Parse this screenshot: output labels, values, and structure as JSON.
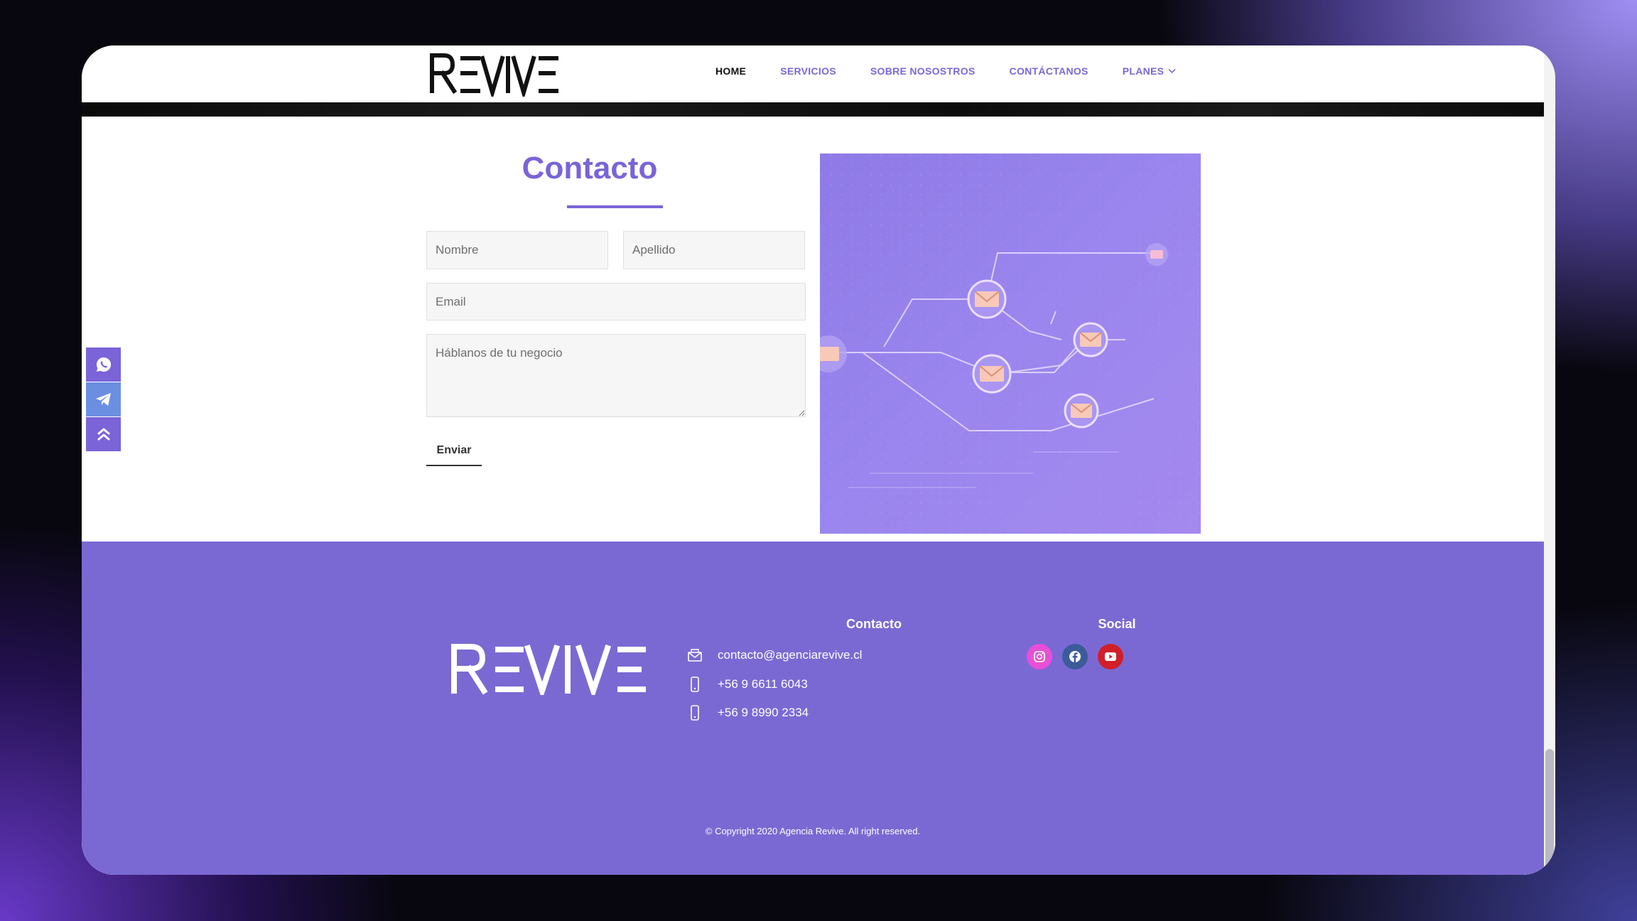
{
  "brand": {
    "name": "REVIVE"
  },
  "nav": {
    "items": [
      {
        "label": "HOME",
        "active": true
      },
      {
        "label": "SERVICIOS",
        "active": false
      },
      {
        "label": "SOBRE NOSOSTROS",
        "active": false
      },
      {
        "label": "CONTÁCTANOS",
        "active": false
      },
      {
        "label": "PLANES",
        "active": false,
        "dropdown": true
      }
    ]
  },
  "contact_form": {
    "title": "Contacto",
    "first_name_placeholder": "Nombre",
    "last_name_placeholder": "Apellido",
    "email_placeholder": "Email",
    "message_placeholder": "Háblanos de tu negocio",
    "submit_label": "Enviar"
  },
  "side_buttons": [
    {
      "icon": "whatsapp-icon",
      "color": "#7b63d8"
    },
    {
      "icon": "telegram-icon",
      "color": "#6b8fe0"
    },
    {
      "icon": "scroll-top-icon",
      "color": "#7b63d8"
    }
  ],
  "footer": {
    "contact_heading": "Contacto",
    "email": "contacto@agenciarevive.cl",
    "phone_1": "+56 9 6611 6043",
    "phone_2": "+56 9 8990 2334",
    "social_heading": "Social",
    "social": [
      {
        "icon": "instagram-icon",
        "color": "#e84fd8"
      },
      {
        "icon": "facebook-icon",
        "color": "#3b5b9b"
      },
      {
        "icon": "youtube-icon",
        "color": "#d11f2a"
      }
    ],
    "copyright": "© Copyright 2020 Agencia Revive. All right reserved."
  },
  "colors": {
    "accent": "#7b63d8",
    "footer_bg": "#7b69d3",
    "nav_link": "#7b68d6"
  }
}
